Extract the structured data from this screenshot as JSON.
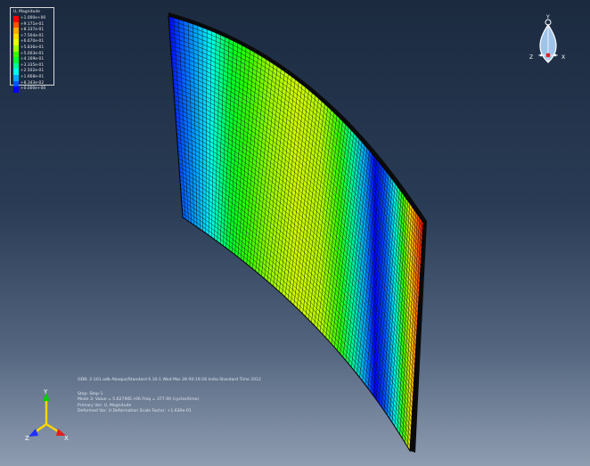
{
  "legend": {
    "title": "U, Magnitude",
    "entries": [
      {
        "value": "+1.000e+00",
        "color": "#ff0000"
      },
      {
        "value": "+9.171e-01",
        "color": "#ff5500"
      },
      {
        "value": "+8.337e-01",
        "color": "#ffaa00"
      },
      {
        "value": "+7.504e-01",
        "color": "#ffd900"
      },
      {
        "value": "+6.670e-01",
        "color": "#e6ff00"
      },
      {
        "value": "+5.836e-01",
        "color": "#9bff00"
      },
      {
        "value": "+5.003e-01",
        "color": "#33ff00"
      },
      {
        "value": "+4.169e-01",
        "color": "#00ff33"
      },
      {
        "value": "+3.335e-01",
        "color": "#00ff99"
      },
      {
        "value": "+2.502e-01",
        "color": "#00ffee"
      },
      {
        "value": "+1.668e-01",
        "color": "#00a8ff"
      },
      {
        "value": "+8.343e-02",
        "color": "#0055ff"
      },
      {
        "value": "+0.000e+00",
        "color": "#0000ff"
      }
    ]
  },
  "info": {
    "odb_line": "ODB: 2-161.odb    Abaqus/Standard 6.10-1    Wed Mar 28 00:19:28 India Standard Time 2012",
    "step_line": "Step: Step-1",
    "mode_line": "Mode        3: Value =  5.62790E+06 Freq =   377.90    (cycles/time)",
    "primary_line": "Primary Var: U, Magnitude",
    "deformed_line": "Deformed Var: U   Deformation Scale Factor: +1.630e-01"
  },
  "triad": {
    "y": "Y",
    "x": "X",
    "z": "Z"
  },
  "compass": {
    "y": "Y",
    "x": "X",
    "z": "Z"
  },
  "colors": {
    "bg_top": "#1b2a3f",
    "bg_bottom": "#8f9db1",
    "mesh_line": "#111111"
  }
}
